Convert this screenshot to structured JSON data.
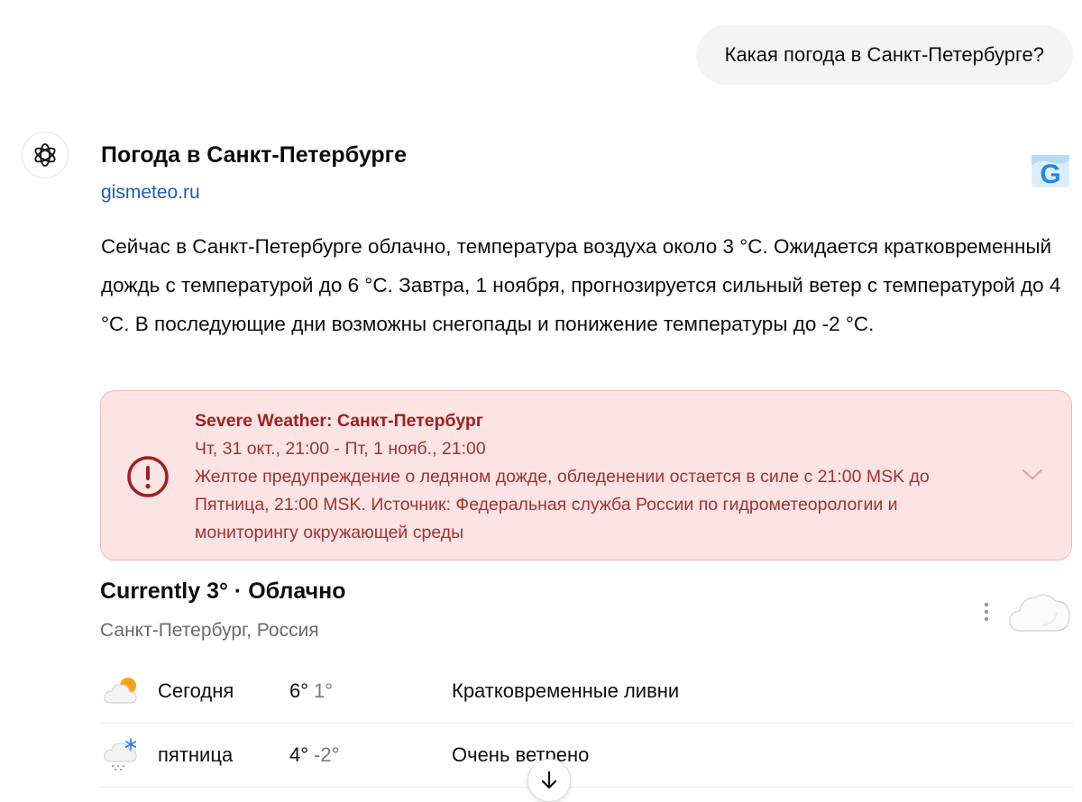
{
  "user_message": "Какая погода в Санкт-Петербурге?",
  "source": {
    "title": "Погода в Санкт-Петербурге",
    "domain": "gismeteo.ru",
    "favicon_letter": "G"
  },
  "answer_text": "Сейчас в Санкт-Петербурге облачно, температура воздуха около 3 °C. Ожидается кратковременный дождь с температурой до 6 °C. Завтра, 1 ноября, прогнозируется сильный ветер с температурой до 4 °C. В последующие дни возможны снегопады и понижение температуры до -2 °C.",
  "alert": {
    "title": "Severe Weather: Санкт-Петербург",
    "time": "Чт, 31 окт., 21:00 - Пт, 1 нояб., 21:00",
    "body": "Желтое предупреждение о ледяном дожде, обледенении остается в силе с 21:00 MSK до Пятница, 21:00 MSK. Источник: Федеральная служба России по гидрометеорологии и мониторингу окружающей среды",
    "icon": "exclamation-circle-icon"
  },
  "weather": {
    "headline": "Currently 3° · Облачно",
    "location": "Санкт-Петербург, Россия",
    "forecast": [
      {
        "day": "Сегодня",
        "high": "6°",
        "low": "1°",
        "desc": "Кратковременные ливни",
        "icon": "partly-sunny-cloud-icon"
      },
      {
        "day": "пятница",
        "high": "4°",
        "low": "-2°",
        "desc": "Очень ветрено",
        "icon": "snow-cloud-icon"
      }
    ]
  },
  "colors": {
    "alert_background": "#fde4e4",
    "alert_text": "#a01f1f",
    "link": "#1a5fb4"
  }
}
